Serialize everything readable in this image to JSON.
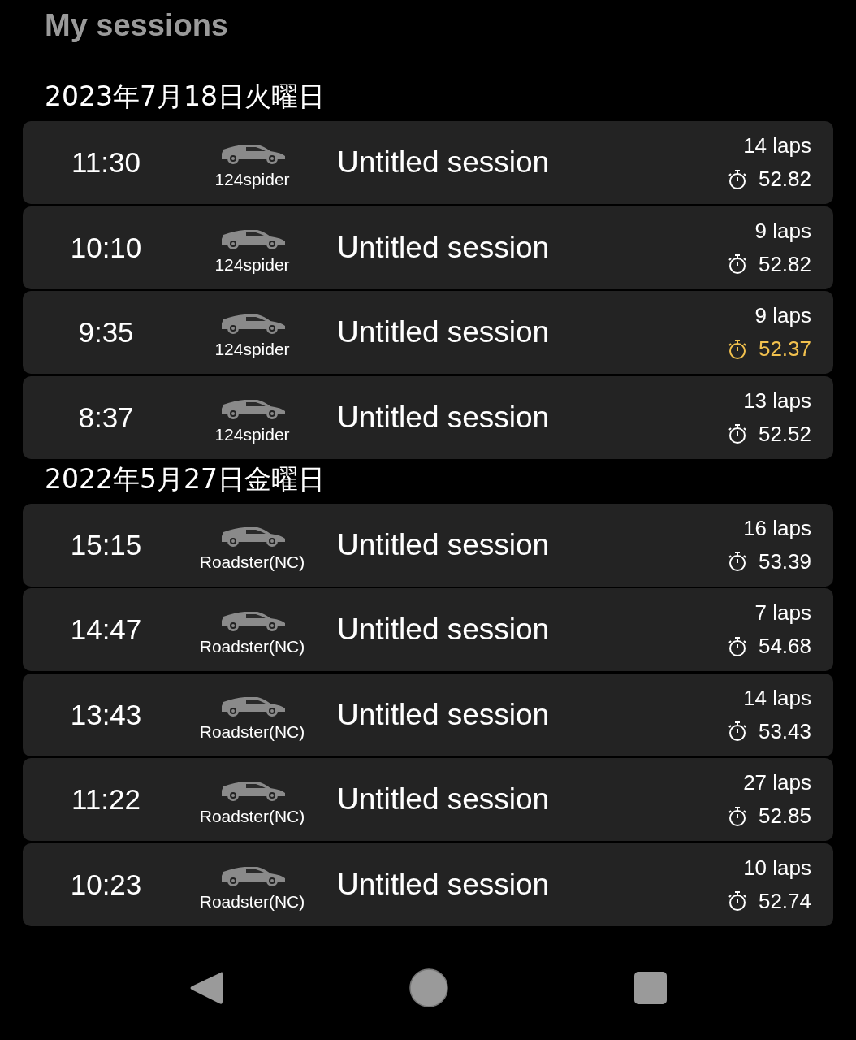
{
  "title": "My sessions",
  "groups": [
    {
      "date": "2023年7月18日火曜日",
      "sessions": [
        {
          "time": "11:30",
          "car": "124spider",
          "name": "Untitled session",
          "laps": "14 laps",
          "best_lap": "52.82",
          "personal_best": false
        },
        {
          "time": "10:10",
          "car": "124spider",
          "name": "Untitled session",
          "laps": "9 laps",
          "best_lap": "52.82",
          "personal_best": false
        },
        {
          "time": "9:35",
          "car": "124spider",
          "name": "Untitled session",
          "laps": "9 laps",
          "best_lap": "52.37",
          "personal_best": true
        },
        {
          "time": "8:37",
          "car": "124spider",
          "name": "Untitled session",
          "laps": "13 laps",
          "best_lap": "52.52",
          "personal_best": false
        }
      ]
    },
    {
      "date": "2022年5月27日金曜日",
      "sessions": [
        {
          "time": "15:15",
          "car": "Roadster(NC)",
          "name": "Untitled session",
          "laps": "16 laps",
          "best_lap": "53.39",
          "personal_best": false
        },
        {
          "time": "14:47",
          "car": "Roadster(NC)",
          "name": "Untitled session",
          "laps": "7 laps",
          "best_lap": "54.68",
          "personal_best": false
        },
        {
          "time": "13:43",
          "car": "Roadster(NC)",
          "name": "Untitled session",
          "laps": "14 laps",
          "best_lap": "53.43",
          "personal_best": false
        },
        {
          "time": "11:22",
          "car": "Roadster(NC)",
          "name": "Untitled session",
          "laps": "27 laps",
          "best_lap": "52.85",
          "personal_best": false
        },
        {
          "time": "10:23",
          "car": "Roadster(NC)",
          "name": "Untitled session",
          "laps": "10 laps",
          "best_lap": "52.74",
          "personal_best": false
        }
      ]
    }
  ]
}
